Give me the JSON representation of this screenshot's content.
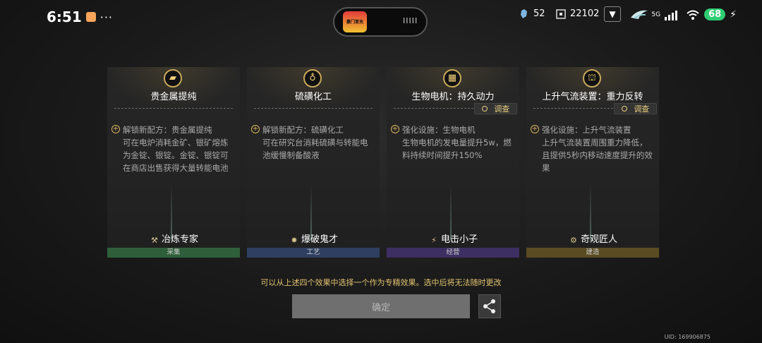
{
  "status_bar": {
    "time": "6:51",
    "battery": "68",
    "signal_badge": "5G",
    "more": "···"
  },
  "hud": {
    "banner_ad_label": "豪门首充",
    "banner_text": "IIIII",
    "currency_1": "52",
    "currency_2": "22102"
  },
  "cards": [
    {
      "title": "贵金属提纯",
      "icon": "gold-bar-icon",
      "has_investigate": false,
      "lines": [
        "解锁新配方：贵金属提纯",
        "可在电炉消耗金矿、银矿熔炼为金锭、银锭。金锭、银锭可在商店出售获得大量转能电池"
      ],
      "role": "冶炼专家",
      "category": "采集",
      "category_color": "#2f5f3a"
    },
    {
      "title": "硫磺化工",
      "icon": "bottle-icon",
      "has_investigate": false,
      "lines": [
        "解锁新配方：硫磺化工",
        "可在研究台消耗硫磺与转能电池缓慢制备酸液"
      ],
      "role": "爆破鬼才",
      "category": "工艺",
      "category_color": "#2e3f62"
    },
    {
      "title": "生物电机：持久动力",
      "icon": "generator-icon",
      "has_investigate": true,
      "lines": [
        "强化设施：生物电机",
        "生物电机的发电量提升5w，燃料持续时间提升150%"
      ],
      "role": "电击小子",
      "category": "经营",
      "category_color": "#3d2f62"
    },
    {
      "title": "上升气流装置：重力反转",
      "icon": "updraft-icon",
      "has_investigate": true,
      "lines": [
        "强化设施：上升气流装置",
        "上升气流装置周围重力降低，且提供5秒内移动速度提升的效果"
      ],
      "role": "奇观匠人",
      "category": "建造",
      "category_color": "#5b4b22"
    }
  ],
  "investigate_label": "调查",
  "hint": "可以从上述四个效果中选择一个作为专精效果。选中后将无法随时更改",
  "confirm_label": "确定",
  "uid": "UID: 169906875"
}
